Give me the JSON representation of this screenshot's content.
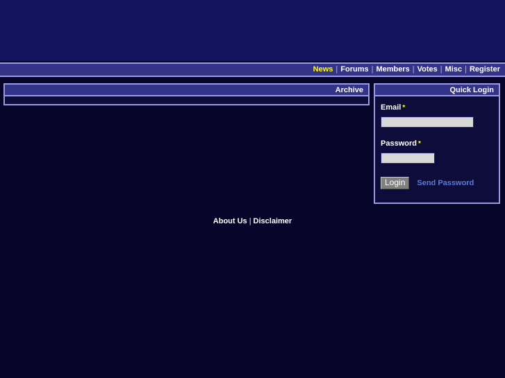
{
  "banner": {
    "background_color": "#11135c"
  },
  "nav": {
    "items": [
      {
        "label": "News",
        "active": true
      },
      {
        "label": "Forums",
        "active": false
      },
      {
        "label": "Members",
        "active": false
      },
      {
        "label": "Votes",
        "active": false
      },
      {
        "label": "Misc",
        "active": false
      },
      {
        "label": "Register",
        "active": false
      }
    ],
    "separator": "|",
    "active_color": "#ffff00",
    "background_color": "#333388"
  },
  "archive_panel": {
    "title": "Archive",
    "body_text": ""
  },
  "login_panel": {
    "title": "Quick Login",
    "email": {
      "label": "Email",
      "required_marker": "*",
      "value": "",
      "placeholder": ""
    },
    "password": {
      "label": "Password",
      "required_marker": "*",
      "value": "",
      "placeholder": ""
    },
    "login_button": "Login",
    "send_password_link": "Send Password"
  },
  "footer": {
    "about_label": "About Us",
    "separator": "|",
    "disclaimer_label": "Disclaimer"
  },
  "colors": {
    "page_background": "#060529",
    "panel_background": "#0d0c3a",
    "panel_border": "#9a9ade",
    "accent_blue": "#333388",
    "required_yellow": "#ffff33",
    "link_blue": "#5a7ad8",
    "input_background": "#d8d8d8"
  }
}
